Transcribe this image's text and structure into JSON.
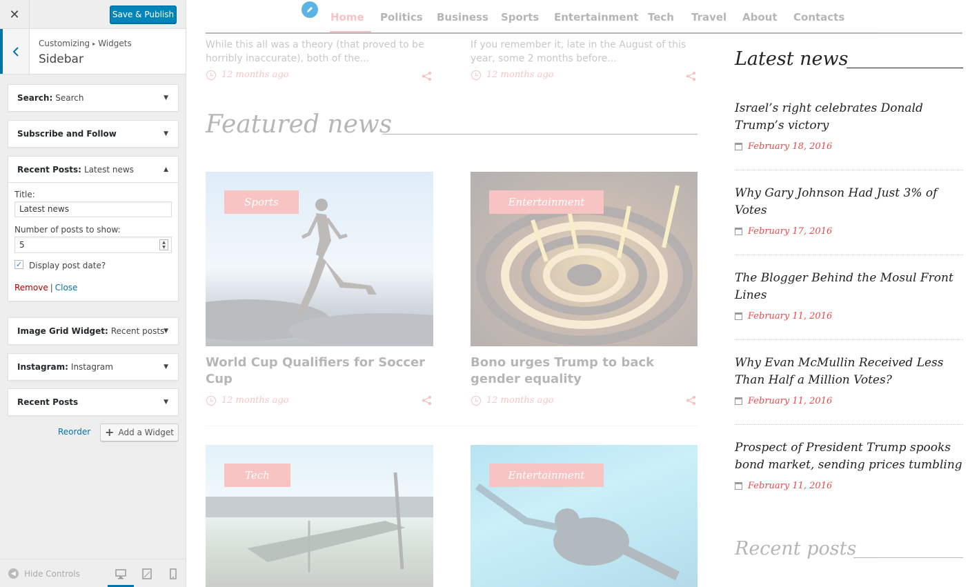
{
  "customizer": {
    "close_label": "✕",
    "publish_label": "Save & Publish",
    "breadcrumb": [
      "Customizing",
      "Widgets"
    ],
    "breadcrumb_sep": "▸",
    "section_title": "Sidebar",
    "widgets": [
      {
        "type": "Search",
        "title": "Search"
      },
      {
        "type": "Subscribe and Follow",
        "title": ""
      },
      {
        "type": "Recent Posts",
        "title": "Latest news"
      },
      {
        "type": "Image Grid Widget",
        "title": "Recent posts"
      },
      {
        "type": "Instagram",
        "title": "Instagram"
      },
      {
        "type": "Recent Posts",
        "title": ""
      }
    ],
    "widget_sep": ":",
    "open_widget": {
      "title_label": "Title:",
      "title_value": "Latest news",
      "count_label": "Number of posts to show:",
      "count_value": "5",
      "display_date_label": "Display post date?",
      "display_date_checked": "✓",
      "remove_label": "Remove",
      "pipe": "|",
      "close_label": "Close"
    },
    "reorder_label": "Reorder",
    "add_widget_label": "Add a Widget",
    "add_widget_plus": "+",
    "hide_controls_label": "Hide Controls"
  },
  "preview": {
    "nav": [
      "Home",
      "Politics",
      "Business",
      "Sports",
      "Entertainment",
      "Tech",
      "Travel",
      "About",
      "Contacts"
    ],
    "nav_active": "Home",
    "excerpts": [
      "While this all was a theory (that proved to be horribly inaccurate), both of the...",
      "If you remember it, late in the August of this year, some 2 months before..."
    ],
    "time_ago": "12 months ago",
    "featured_title": "Featured news",
    "cards": [
      {
        "tag": "Sports",
        "title": "World Cup Qualifiers for Soccer Cup"
      },
      {
        "tag": "Entertainment",
        "title": "Bono urges Trump to back gender equality"
      },
      {
        "tag": "Tech",
        "title": ""
      },
      {
        "tag": "Entertainment",
        "title": ""
      }
    ],
    "latest_news_title": "Latest news",
    "latest_news": [
      {
        "title": "Israel’s right celebrates Donald Trump’s victory",
        "date": "February 18, 2016"
      },
      {
        "title": "Why Gary Johnson Had Just 3% of Votes",
        "date": "February 17, 2016"
      },
      {
        "title": "The Blogger Behind the Mosul Front Lines",
        "date": "February 11, 2016"
      },
      {
        "title": "Why Evan McMullin Received Less Than Half a Million Votes?",
        "date": "February 11, 2016"
      },
      {
        "title": "Prospect of President Trump spooks bond market, sending prices tumbling",
        "date": "February 11, 2016"
      }
    ],
    "recent_posts_title": "Recent posts"
  },
  "colors": {
    "accent": "#e8494b",
    "wp_blue": "#0085ba",
    "link": "#0073aa"
  }
}
